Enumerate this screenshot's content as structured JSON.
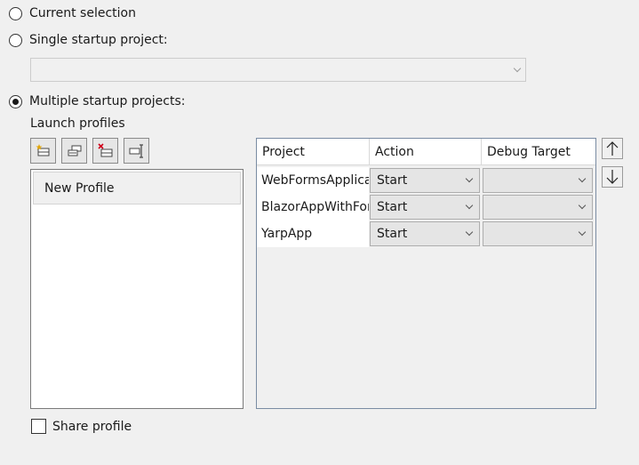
{
  "options": {
    "current_selection": "Current selection",
    "single_startup": "Single startup project:",
    "multiple_startup": "Multiple startup projects:"
  },
  "launch_profiles": {
    "label": "Launch profiles",
    "toolbar_icons": [
      "new-profile-icon",
      "duplicate-profile-icon",
      "delete-profile-icon",
      "rename-profile-icon"
    ],
    "items": [
      "New Profile"
    ]
  },
  "grid": {
    "headers": [
      "Project",
      "Action",
      "Debug Target"
    ],
    "rows": [
      {
        "project": "WebFormsApplication",
        "action": "Start",
        "debug_target": ""
      },
      {
        "project": "BlazorAppWithForms",
        "action": "Start",
        "debug_target": ""
      },
      {
        "project": "YarpApp",
        "action": "Start",
        "debug_target": ""
      }
    ]
  },
  "share_profile": "Share profile",
  "colors": {
    "background": "#f0f0f0",
    "grid_border": "#7a8ca3",
    "icon_red": "#d0021b",
    "icon_gold": "#e2a400"
  }
}
